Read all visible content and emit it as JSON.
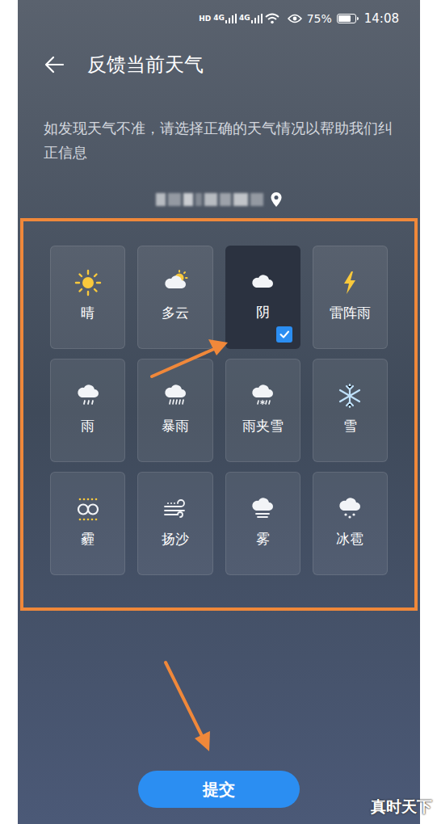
{
  "status_bar": {
    "network": [
      "HD",
      "4G",
      "4G"
    ],
    "battery": "75%",
    "battery_level": 0.75,
    "time": "14:08"
  },
  "header": {
    "title": "反馈当前天气"
  },
  "description": "如发现天气不准，请选择正确的天气情况以帮助我们纠正信息",
  "weather_options": [
    {
      "label": "晴",
      "kind": "sunny",
      "selected": false
    },
    {
      "label": "多云",
      "kind": "cloudy",
      "selected": false
    },
    {
      "label": "阴",
      "kind": "overcast",
      "selected": true
    },
    {
      "label": "雷阵雨",
      "kind": "thunder",
      "selected": false
    },
    {
      "label": "雨",
      "kind": "rain",
      "selected": false
    },
    {
      "label": "暴雨",
      "kind": "storm",
      "selected": false
    },
    {
      "label": "雨夹雪",
      "kind": "sleet",
      "selected": false
    },
    {
      "label": "雪",
      "kind": "snow",
      "selected": false
    },
    {
      "label": "霾",
      "kind": "haze",
      "selected": false
    },
    {
      "label": "扬沙",
      "kind": "sand",
      "selected": false
    },
    {
      "label": "雾",
      "kind": "fog",
      "selected": false
    },
    {
      "label": "冰雹",
      "kind": "hail",
      "selected": false
    }
  ],
  "submit_button": "提交",
  "watermark": "真时天下"
}
